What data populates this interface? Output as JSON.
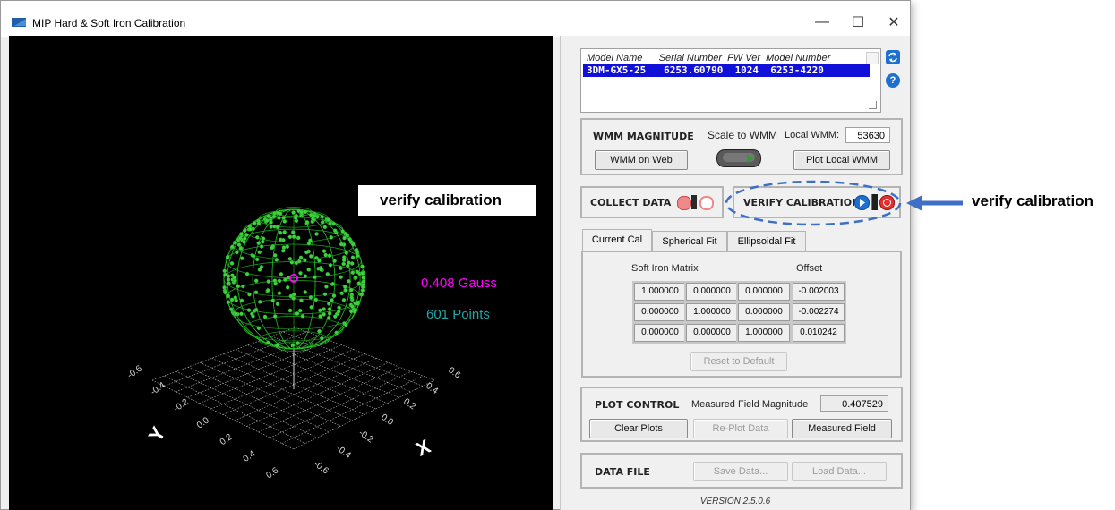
{
  "window": {
    "title": "MIP Hard & Soft Iron Calibration",
    "controls": {
      "minimize": "—",
      "maximize": "☐",
      "close": "✕"
    }
  },
  "plot": {
    "magnitude_text": "0.408 Gauss",
    "points_text": "601 Points",
    "x_axis_label": "X",
    "y_axis_label": "Y",
    "x_ticks": [
      "0.6",
      "0.4",
      "0.2",
      "0.0",
      "-0.2",
      "-0.4",
      "-0.6"
    ],
    "y_ticks": [
      "-0.6",
      "-0.4",
      "-0.2",
      "0.0",
      "0.2",
      "0.4",
      "0.6"
    ],
    "colors": {
      "sphere": "#22c122",
      "magnitude": "#ff00ff",
      "points": "#1fa6a6",
      "grid": "#bfbfbf"
    }
  },
  "device_list": {
    "header": "Model Name      Serial Number  FW Ver  Model Number",
    "row": "3DM-GX5-25   6253.60790  1024  6253-4220",
    "refresh_icon": "refresh-icon",
    "help_icon": "help-icon",
    "help_text": "?"
  },
  "wmm": {
    "title": "WMM MAGNITUDE",
    "scale_label": "Scale to WMM",
    "local_label": "Local WMM:",
    "local_value": "53630",
    "web_button": "WMM on Web",
    "plot_button": "Plot Local WMM"
  },
  "collect": {
    "title": "COLLECT DATA"
  },
  "verify": {
    "title": "VERIFY CALIBRATION"
  },
  "tabs": [
    {
      "label": "Current Cal"
    },
    {
      "label": "Spherical Fit"
    },
    {
      "label": "Ellipsoidal Fit"
    }
  ],
  "calibration": {
    "matrix_label": "Soft Iron Matrix",
    "offset_label": "Offset",
    "matrix": [
      [
        "1.000000",
        "0.000000",
        "0.000000"
      ],
      [
        "0.000000",
        "1.000000",
        "0.000000"
      ],
      [
        "0.000000",
        "0.000000",
        "1.000000"
      ]
    ],
    "offset": [
      "-0.002003",
      "-0.002274",
      "0.010242"
    ],
    "reset_button": "Reset to Default"
  },
  "plot_control": {
    "title": "PLOT CONTROL",
    "measured_label": "Measured Field Magnitude",
    "measured_value": "0.407529",
    "clear_button": "Clear Plots",
    "replot_button": "Re-Plot Data",
    "measured_button": "Measured Field"
  },
  "data_file": {
    "title": "DATA FILE",
    "save_button": "Save Data...",
    "load_button": "Load Data..."
  },
  "version": "VERSION  2.5.0.6",
  "annotations": {
    "left_callout": "verify calibration",
    "right_callout": "verify calibration",
    "accent": "#3d6fc4"
  }
}
